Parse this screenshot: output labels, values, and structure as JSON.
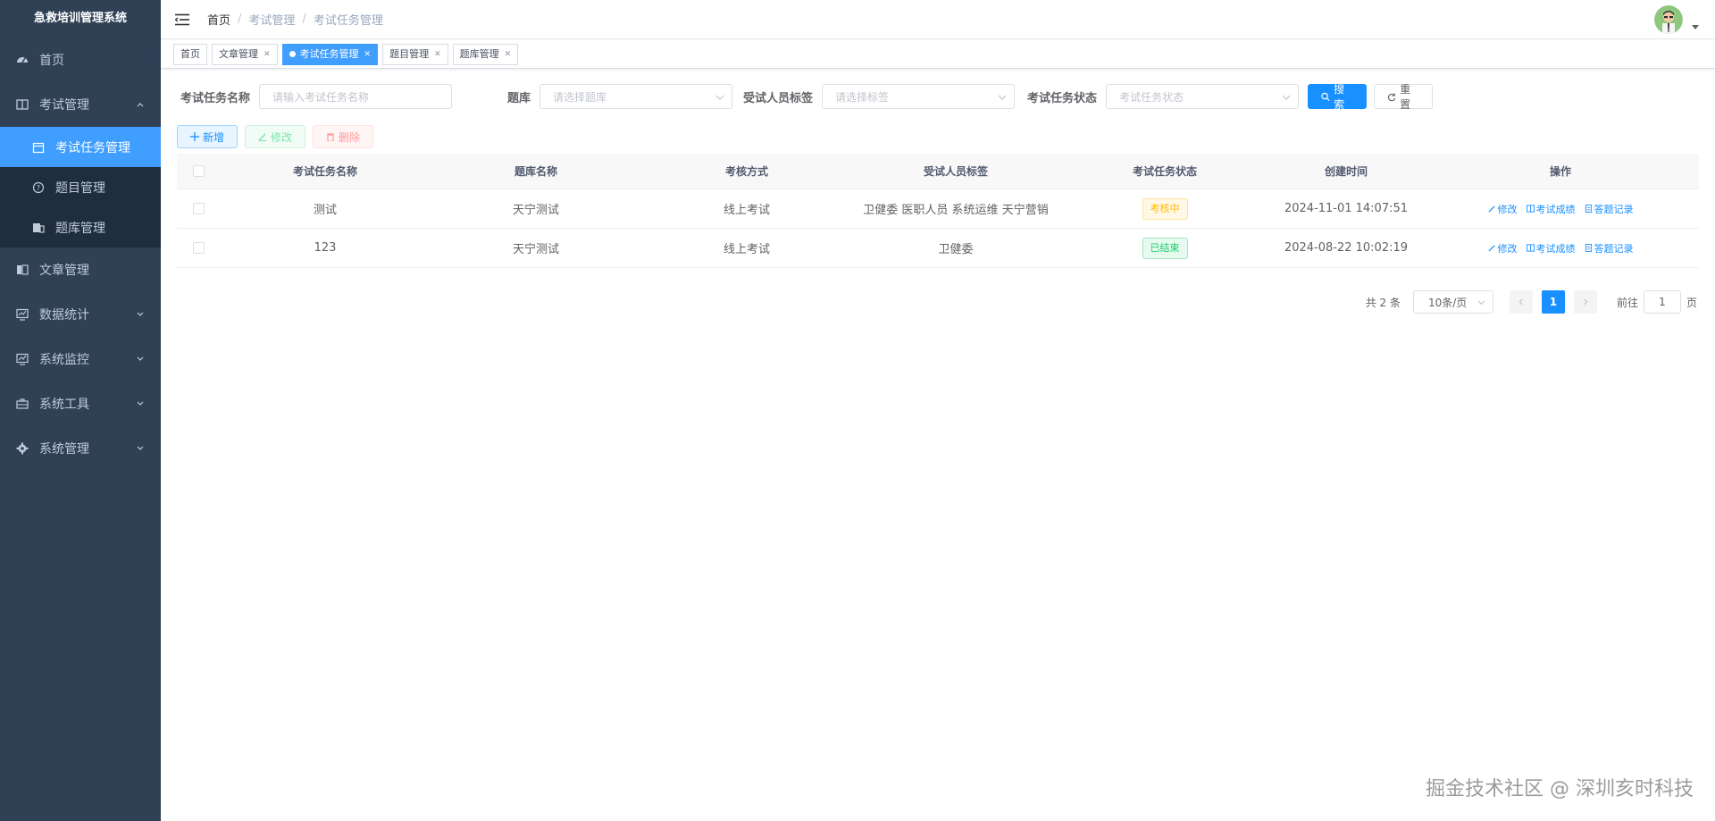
{
  "sidebar": {
    "title": "急救培训管理系统",
    "items": [
      {
        "label": "首页",
        "icon": "dashboard-icon"
      },
      {
        "label": "考试管理",
        "icon": "book-icon",
        "expanded": true,
        "children": [
          {
            "label": "考试任务管理",
            "icon": "calendar-icon",
            "active": true
          },
          {
            "label": "题目管理",
            "icon": "question-icon"
          },
          {
            "label": "题库管理",
            "icon": "database-icon"
          }
        ]
      },
      {
        "label": "文章管理",
        "icon": "article-icon"
      },
      {
        "label": "数据统计",
        "icon": "monitor-icon"
      },
      {
        "label": "系统监控",
        "icon": "monitor-icon"
      },
      {
        "label": "系统工具",
        "icon": "toolbox-icon"
      },
      {
        "label": "系统管理",
        "icon": "gear-icon"
      }
    ]
  },
  "breadcrumb": [
    "首页",
    "考试管理",
    "考试任务管理"
  ],
  "tags": [
    {
      "label": "首页",
      "closable": false,
      "active": false
    },
    {
      "label": "文章管理",
      "closable": true,
      "active": false
    },
    {
      "label": "考试任务管理",
      "closable": true,
      "active": true
    },
    {
      "label": "题目管理",
      "closable": true,
      "active": false
    },
    {
      "label": "题库管理",
      "closable": true,
      "active": false
    }
  ],
  "search": {
    "name_label": "考试任务名称",
    "name_placeholder": "请输入考试任务名称",
    "bank_label": "题库",
    "bank_placeholder": "请选择题库",
    "tag_label": "受试人员标签",
    "tag_placeholder": "请选择标签",
    "status_label": "考试任务状态",
    "status_placeholder": "考试任务状态",
    "search_button": "搜索",
    "reset_button": "重置"
  },
  "toolbar": {
    "add": "新增",
    "edit": "修改",
    "delete": "删除"
  },
  "table": {
    "columns": [
      "考试任务名称",
      "题库名称",
      "考核方式",
      "受试人员标签",
      "考试任务状态",
      "创建时间",
      "操作"
    ],
    "rows": [
      {
        "name": "测试",
        "bank": "天宁测试",
        "method": "线上考试",
        "tags": "卫健委 医职人员 系统运维 天宁营销",
        "status": "考核中",
        "status_type": "warn",
        "created": "2024-11-01 14:07:51"
      },
      {
        "name": "123",
        "bank": "天宁测试",
        "method": "线上考试",
        "tags": "卫健委",
        "status": "已结束",
        "status_type": "success",
        "created": "2024-08-22 10:02:19"
      }
    ],
    "actions": {
      "edit": "修改",
      "scores": "考试成绩",
      "records": "答题记录"
    }
  },
  "pagination": {
    "total": "共 2 条",
    "page_size": "10条/页",
    "current": "1",
    "goto_prefix": "前往",
    "goto_value": "1",
    "goto_suffix": "页"
  },
  "watermark": "掘金技术社区 @ 深圳亥时科技",
  "colors": {
    "sidebar_bg": "#304156",
    "primary": "#1890ff",
    "active_menu": "#409eff"
  }
}
